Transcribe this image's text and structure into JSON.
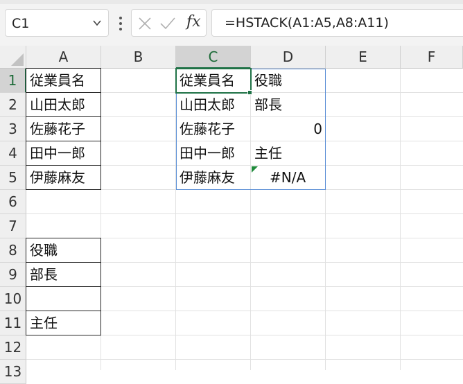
{
  "name_box": {
    "value": "C1"
  },
  "formula_bar": {
    "formula": "=HSTACK(A1:A5,A8:A11)",
    "fx_label": "fx"
  },
  "columns": [
    "A",
    "B",
    "C",
    "D",
    "E",
    "F"
  ],
  "active_column": "C",
  "rows": [
    "1",
    "2",
    "3",
    "4",
    "5",
    "6",
    "7",
    "8",
    "9",
    "10",
    "11",
    "12",
    "13"
  ],
  "active_row": "1",
  "cells": {
    "A1": "従業員名",
    "A2": "山田太郎",
    "A3": "佐藤花子",
    "A4": "田中一郎",
    "A5": "伊藤麻友",
    "A8": "役職",
    "A9": "部長",
    "A10": "",
    "A11": "主任",
    "C1": "従業員名",
    "C2": "山田太郎",
    "C3": "佐藤花子",
    "C4": "田中一郎",
    "C5": "伊藤麻友",
    "D1": "役職",
    "D2": "部長",
    "D3": "0",
    "D4": "主任",
    "D5": "#N/A"
  },
  "colors": {
    "accent": "#1f7246",
    "spill_border": "#5b8fd6",
    "error_indicator": "#1f8a3a"
  }
}
